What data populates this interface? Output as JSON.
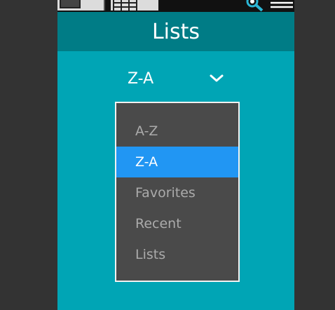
{
  "screen": {
    "title": "Lists"
  },
  "toolbar": {
    "icons": [
      "window-icon",
      "grid-icon",
      "search-tools-icon",
      "menu-icon"
    ]
  },
  "sort": {
    "selected_value": "Z-A",
    "dropdown_icon": "chevron-down-icon",
    "options": [
      {
        "label": "A-Z",
        "selected": false
      },
      {
        "label": "Z-A",
        "selected": true
      },
      {
        "label": "Favorites",
        "selected": false
      },
      {
        "label": "Recent",
        "selected": false
      },
      {
        "label": "Lists",
        "selected": false
      }
    ]
  },
  "colors": {
    "background": "#00a5b5",
    "header": "#007c86",
    "menu_bg": "#4a4a4a",
    "selected": "#2196f3",
    "option_text": "#ababab"
  }
}
